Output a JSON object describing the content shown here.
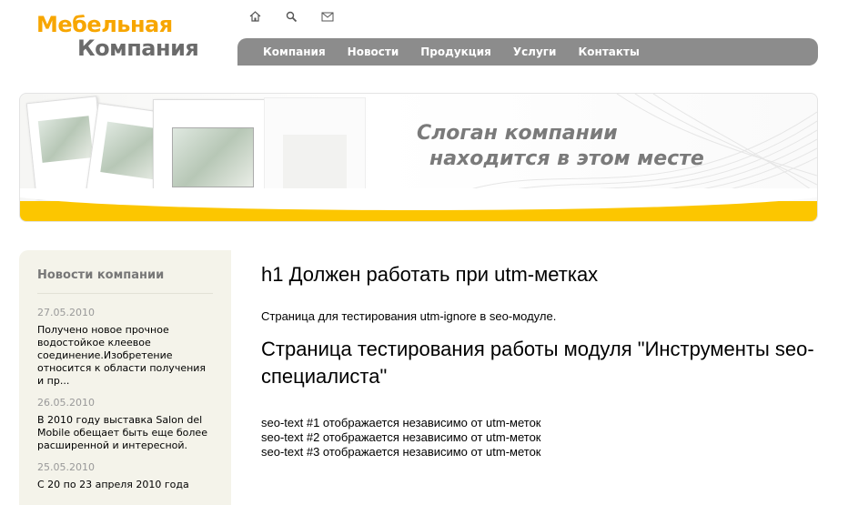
{
  "logo": {
    "line1": "Мебельная",
    "line2": "Компания"
  },
  "top_icons": [
    "home-icon",
    "search-icon",
    "mail-icon"
  ],
  "nav": {
    "items": [
      {
        "label": "Компания"
      },
      {
        "label": "Новости"
      },
      {
        "label": "Продукция"
      },
      {
        "label": "Услуги"
      },
      {
        "label": "Контакты"
      }
    ]
  },
  "banner": {
    "slogan_line1": "Слоган компании",
    "slogan_line2": "находится в этом месте"
  },
  "sidebar": {
    "title": "Новости компании",
    "news": [
      {
        "date": "27.05.2010",
        "text": "Получено новое прочное водостойкое клеевое соединение.Изобретение относится к области получения и пр..."
      },
      {
        "date": "26.05.2010",
        "text": "В 2010 году выставка Salon del Mobile обещает быть еще более расширенной и интересной."
      },
      {
        "date": "25.05.2010",
        "text": "С 20 по 23 апреля 2010 года"
      }
    ]
  },
  "main": {
    "h1": "h1 Должен работать при utm-метках",
    "intro": "Страница для тестирования utm-ignore в seo-модуле.",
    "h2": "Страница тестирования работы модуля \"Инструменты seo-специалиста\"",
    "seo_lines": [
      "seo-text #1 отображается независимо от utm-меток",
      "seo-text #2 отображается независимо от utm-меток",
      "seo-text #3 отображается независимо от utm-меток"
    ]
  },
  "colors": {
    "accent": "#f7a600",
    "nav": "#8c8c8c",
    "banner_yellow": "#fcc600",
    "sidebar_bg": "#f4f3ea"
  }
}
